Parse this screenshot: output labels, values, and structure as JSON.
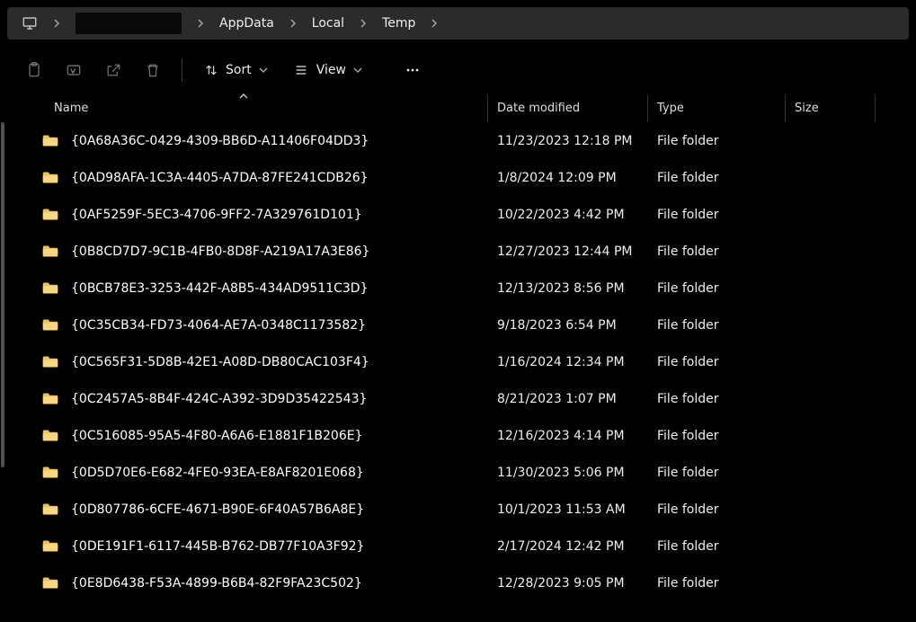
{
  "breadcrumbs": {
    "seg_appdata": "AppData",
    "seg_local": "Local",
    "seg_temp": "Temp"
  },
  "toolbar": {
    "sort_label": "Sort",
    "view_label": "View"
  },
  "columns": {
    "name": "Name",
    "date": "Date modified",
    "type": "Type",
    "size": "Size"
  },
  "rows": [
    {
      "name": "{0A68A36C-0429-4309-BB6D-A11406F04DD3}",
      "date": "11/23/2023 12:18 PM",
      "type": "File folder",
      "size": ""
    },
    {
      "name": "{0AD98AFA-1C3A-4405-A7DA-87FE241CDB26}",
      "date": "1/8/2024 12:09 PM",
      "type": "File folder",
      "size": ""
    },
    {
      "name": "{0AF5259F-5EC3-4706-9FF2-7A329761D101}",
      "date": "10/22/2023 4:42 PM",
      "type": "File folder",
      "size": ""
    },
    {
      "name": "{0B8CD7D7-9C1B-4FB0-8D8F-A219A17A3E86}",
      "date": "12/27/2023 12:44 PM",
      "type": "File folder",
      "size": ""
    },
    {
      "name": "{0BCB78E3-3253-442F-A8B5-434AD9511C3D}",
      "date": "12/13/2023 8:56 PM",
      "type": "File folder",
      "size": ""
    },
    {
      "name": "{0C35CB34-FD73-4064-AE7A-0348C1173582}",
      "date": "9/18/2023 6:54 PM",
      "type": "File folder",
      "size": ""
    },
    {
      "name": "{0C565F31-5D8B-42E1-A08D-DB80CAC103F4}",
      "date": "1/16/2024 12:34 PM",
      "type": "File folder",
      "size": ""
    },
    {
      "name": "{0C2457A5-8B4F-424C-A392-3D9D35422543}",
      "date": "8/21/2023 1:07 PM",
      "type": "File folder",
      "size": ""
    },
    {
      "name": "{0C516085-95A5-4F80-A6A6-E1881F1B206E}",
      "date": "12/16/2023 4:14 PM",
      "type": "File folder",
      "size": ""
    },
    {
      "name": "{0D5D70E6-E682-4FE0-93EA-E8AF8201E068}",
      "date": "11/30/2023 5:06 PM",
      "type": "File folder",
      "size": ""
    },
    {
      "name": "{0D807786-6CFE-4671-B90E-6F40A57B6A8E}",
      "date": "10/1/2023 11:53 AM",
      "type": "File folder",
      "size": ""
    },
    {
      "name": "{0DE191F1-6117-445B-B762-DB77F10A3F92}",
      "date": "2/17/2024 12:42 PM",
      "type": "File folder",
      "size": ""
    },
    {
      "name": "{0E8D6438-F53A-4899-B6B4-82F9FA23C502}",
      "date": "12/28/2023 9:05 PM",
      "type": "File folder",
      "size": ""
    }
  ]
}
